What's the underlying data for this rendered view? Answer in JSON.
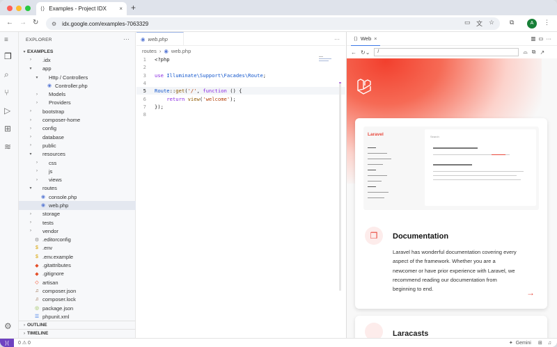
{
  "browser": {
    "tab_title": "Examples - Project IDX",
    "new_tab": "+",
    "url": "idx.google.com/examples-7063329",
    "avatar": "A"
  },
  "colors": {
    "accent": "#3b78e7",
    "laravel_red": "#f53003",
    "status_purple": "#6f42c1"
  },
  "explorer": {
    "title": "EXPLORER",
    "root": "EXAMPLES",
    "items": [
      {
        "label": ".idx",
        "kind": "folder",
        "depth": 1,
        "open": false
      },
      {
        "label": "app",
        "kind": "folder",
        "depth": 1,
        "open": true
      },
      {
        "label": "Http / Controllers",
        "kind": "folder",
        "depth": 2,
        "open": true
      },
      {
        "label": "Controller.php",
        "kind": "php",
        "depth": 3
      },
      {
        "label": "Models",
        "kind": "folder",
        "depth": 2,
        "open": false
      },
      {
        "label": "Providers",
        "kind": "folder",
        "depth": 2,
        "open": false
      },
      {
        "label": "bootstrap",
        "kind": "folder",
        "depth": 1,
        "open": false
      },
      {
        "label": "composer-home",
        "kind": "folder",
        "depth": 1,
        "open": false
      },
      {
        "label": "config",
        "kind": "folder",
        "depth": 1,
        "open": false
      },
      {
        "label": "database",
        "kind": "folder",
        "depth": 1,
        "open": false
      },
      {
        "label": "public",
        "kind": "folder",
        "depth": 1,
        "open": false
      },
      {
        "label": "resources",
        "kind": "folder",
        "depth": 1,
        "open": true
      },
      {
        "label": "css",
        "kind": "folder",
        "depth": 2,
        "open": false
      },
      {
        "label": "js",
        "kind": "folder",
        "depth": 2,
        "open": false
      },
      {
        "label": "views",
        "kind": "folder",
        "depth": 2,
        "open": false
      },
      {
        "label": "routes",
        "kind": "folder",
        "depth": 1,
        "open": true
      },
      {
        "label": "console.php",
        "kind": "php",
        "depth": 2
      },
      {
        "label": "web.php",
        "kind": "php",
        "depth": 2,
        "selected": true
      },
      {
        "label": "storage",
        "kind": "folder",
        "depth": 1,
        "open": false
      },
      {
        "label": "tests",
        "kind": "folder",
        "depth": 1,
        "open": false
      },
      {
        "label": "vendor",
        "kind": "folder",
        "depth": 1,
        "open": false
      },
      {
        "label": ".editorconfig",
        "kind": "gear",
        "depth": 1
      },
      {
        "label": ".env",
        "kind": "dollar",
        "depth": 1
      },
      {
        "label": ".env.example",
        "kind": "dollar",
        "depth": 1
      },
      {
        "label": ".gitattributes",
        "kind": "git",
        "depth": 1
      },
      {
        "label": ".gitignore",
        "kind": "git",
        "depth": 1
      },
      {
        "label": "artisan",
        "kind": "laravel",
        "depth": 1
      },
      {
        "label": "composer.json",
        "kind": "composer",
        "depth": 1
      },
      {
        "label": "composer.lock",
        "kind": "composer",
        "depth": 1
      },
      {
        "label": "package.json",
        "kind": "npm",
        "depth": 1
      },
      {
        "label": "phpunit.xml",
        "kind": "xml",
        "depth": 1
      }
    ],
    "outline": "OUTLINE",
    "timeline": "TIMELINE"
  },
  "editor": {
    "tab": "web.php",
    "breadcrumb": [
      "routes",
      "web.php"
    ],
    "lines": [
      {
        "n": "1",
        "html": "&lt;?php"
      },
      {
        "n": "2",
        "html": ""
      },
      {
        "n": "3",
        "html": "<span class='kw'>use</span> <span class='cls'>Illuminate\\Support\\Facades\\Route</span>;"
      },
      {
        "n": "4",
        "html": ""
      },
      {
        "n": "5",
        "html": "<span class='cls'>Route</span>::<span class='fn'>get</span>(<span class='str'>'/'</span>, <span class='kw'>function</span> () {",
        "current": true
      },
      {
        "n": "6",
        "html": "&nbsp;&nbsp;&nbsp;&nbsp;<span class='kw'>return</span> <span class='fn'>view</span>(<span class='str'>'welcome'</span>);"
      },
      {
        "n": "7",
        "html": "});"
      },
      {
        "n": "8",
        "html": ""
      }
    ]
  },
  "preview": {
    "tab": "Web",
    "path": "/",
    "card": {
      "title": "Documentation",
      "text": "Laravel has wonderful documentation covering every aspect of the framework. Whether you are a newcomer or have prior experience with Laravel, we recommend reading our documentation from beginning to end.",
      "screenshot_logo": "Laravel",
      "screenshot_search": "Search"
    },
    "card2_title": "Laracasts"
  },
  "statusbar": {
    "problems": "0 ⚠ 0",
    "gemini": "Gemini"
  }
}
